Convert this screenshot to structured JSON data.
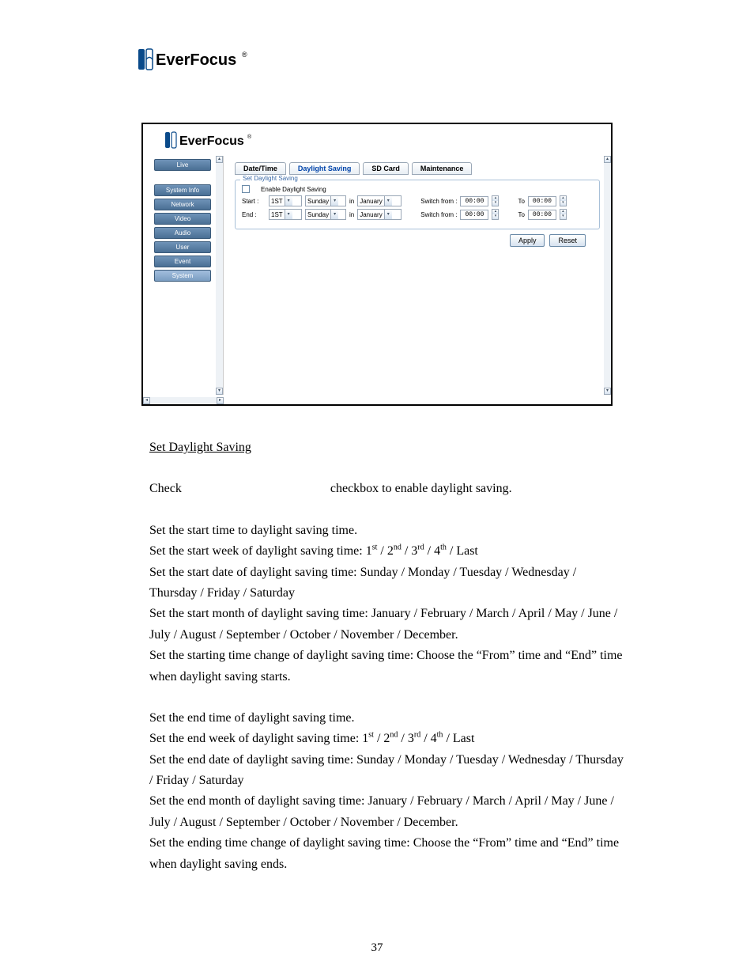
{
  "page_number": "37",
  "brand": "EverFocus",
  "app": {
    "brand": "EverFocus",
    "sidebar": {
      "items": [
        {
          "label": "Live"
        },
        {
          "label": "System Info"
        },
        {
          "label": "Network"
        },
        {
          "label": "Video"
        },
        {
          "label": "Audio"
        },
        {
          "label": "User"
        },
        {
          "label": "Event"
        },
        {
          "label": "System"
        }
      ]
    },
    "tabs": {
      "date_time": "Date/Time",
      "daylight_saving": "Daylight Saving",
      "sd_card": "SD Card",
      "maintenance": "Maintenance"
    },
    "fieldset": {
      "legend": "Set Daylight Saving",
      "enable_label": "Enable Daylight Saving",
      "start_label": "Start :",
      "end_label": "End :",
      "in_label": "in",
      "switch_from_label": "Switch from :",
      "to_label": "To",
      "start": {
        "week": "1ST",
        "day": "Sunday",
        "month": "January",
        "from_time": "00:00",
        "to_time": "00:00"
      },
      "end": {
        "week": "1ST",
        "day": "Sunday",
        "month": "January",
        "from_time": "00:00",
        "to_time": "00:00"
      }
    },
    "buttons": {
      "apply": "Apply",
      "reset": "Reset"
    }
  },
  "doc": {
    "heading": "Set Daylight Saving",
    "p1a": "Check",
    "p1b": "checkbox to enable daylight saving.",
    "b1l1": "Set the start time to daylight saving time.",
    "b1l2a": "Set the start week of daylight saving time: 1",
    "b1l2b": " / 2",
    "b1l2c": " / 3",
    "b1l2d": " / 4",
    "b1l2e": " / Last",
    "sup_st": "st",
    "sup_nd": "nd",
    "sup_rd": "rd",
    "sup_th": "th",
    "b1l3": "Set the start date of daylight saving time: Sunday / Monday / Tuesday / Wednesday / Thursday / Friday / Saturday",
    "b1l4": "Set the start month of daylight saving time: January / February / March / April / May / June / July / August / September / October / November / December.",
    "b1l5": "Set the starting time change of daylight saving time: Choose the “From” time and “End” time when daylight saving starts.",
    "b2l1": "Set the end time of daylight saving time.",
    "b2l2a": "Set the end week of daylight saving time: 1",
    "b2l2b": " / 2",
    "b2l2c": " / 3",
    "b2l2d": " / 4",
    "b2l2e": " / Last",
    "b2l3": "Set the end date of daylight saving time:  Sunday / Monday / Tuesday / Wednesday / Thursday / Friday / Saturday",
    "b2l4": "Set the end month of daylight saving time: January / February / March / April / May / June / July / August / September / October / November / December.",
    "b2l5": "Set the ending time change of daylight saving time: Choose the “From” time and “End” time when daylight saving ends."
  }
}
